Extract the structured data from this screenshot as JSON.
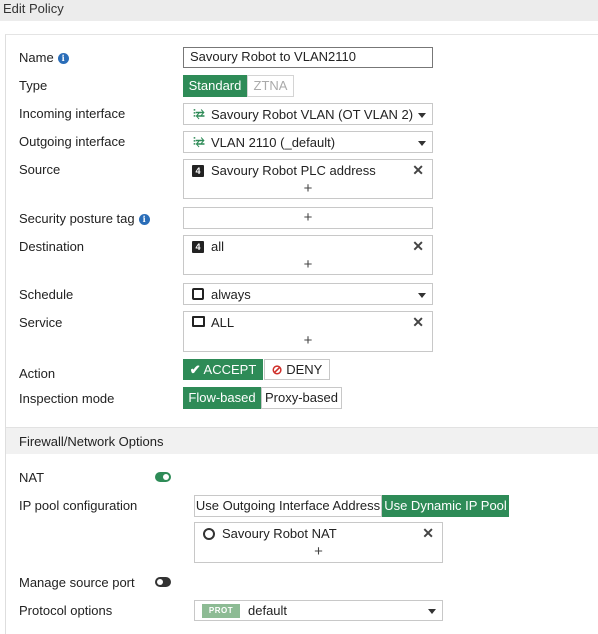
{
  "header": {
    "title": "Edit Policy"
  },
  "form": {
    "name": {
      "label": "Name",
      "value": "Savoury Robot to VLAN2110"
    },
    "type": {
      "label": "Type",
      "options": [
        "Standard",
        "ZTNA"
      ],
      "selected": "Standard"
    },
    "incoming_interface": {
      "label": "Incoming interface",
      "value": "Savoury Robot VLAN (OT VLAN 2)"
    },
    "outgoing_interface": {
      "label": "Outgoing interface",
      "value": "VLAN 2110 (_default)"
    },
    "source": {
      "label": "Source",
      "items": [
        "Savoury Robot PLC address"
      ],
      "add": "+"
    },
    "security_posture_tag": {
      "label": "Security posture tag",
      "add": "+"
    },
    "destination": {
      "label": "Destination",
      "items": [
        "all"
      ],
      "add": "+"
    },
    "schedule": {
      "label": "Schedule",
      "value": "always"
    },
    "service": {
      "label": "Service",
      "items": [
        "ALL"
      ],
      "add": "+"
    },
    "action": {
      "label": "Action",
      "accept": "ACCEPT",
      "deny": "DENY",
      "selected": "ACCEPT"
    },
    "inspection_mode": {
      "label": "Inspection mode",
      "options": [
        "Flow-based",
        "Proxy-based"
      ],
      "selected": "Flow-based"
    }
  },
  "firewall_options": {
    "title": "Firewall/Network Options",
    "nat": {
      "label": "NAT",
      "enabled": true
    },
    "ip_pool": {
      "label": "IP pool configuration",
      "options": [
        "Use Outgoing Interface Address",
        "Use Dynamic IP Pool"
      ],
      "selected": "Use Dynamic IP Pool",
      "items": [
        "Savoury Robot NAT"
      ],
      "add": "+"
    },
    "manage_source_port": {
      "label": "Manage source port",
      "enabled": false
    },
    "protocol_options": {
      "label": "Protocol options",
      "badge": "PROT",
      "value": "default"
    }
  },
  "colors": {
    "accent": "#2e8b57",
    "info": "#2a6db8",
    "deny": "#d0302b"
  },
  "icons": {
    "remove": "✕",
    "info": "i"
  }
}
